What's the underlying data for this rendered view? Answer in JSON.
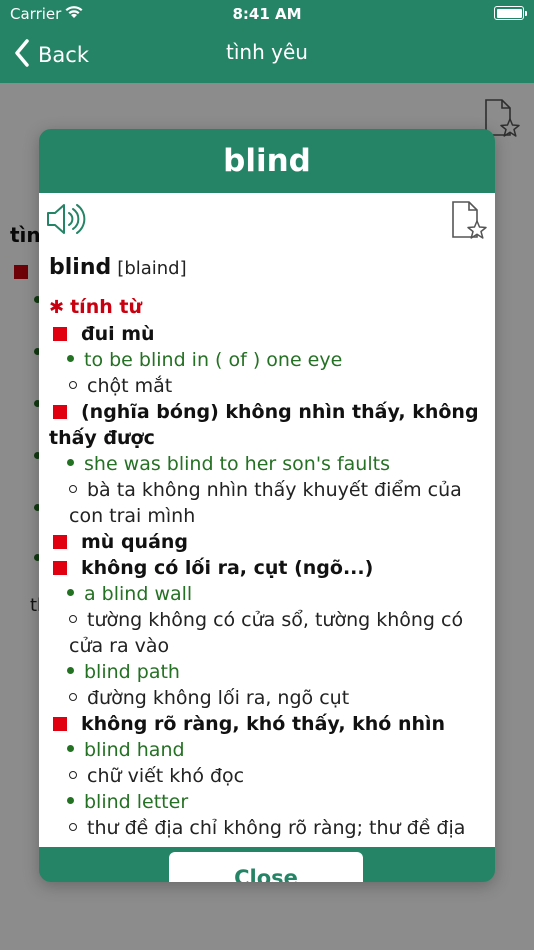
{
  "status": {
    "carrier": "Carrier",
    "time": "8:41 AM"
  },
  "nav": {
    "back_label": "Back",
    "title": "tình yêu"
  },
  "background": {
    "heading_fragment": "tìn",
    "tail_fragment": "th"
  },
  "modal": {
    "title": "blind",
    "word": "blind",
    "pronunciation": "[blaind]",
    "part_of_speech": "tính từ",
    "entries": [
      {
        "def": "đui mù",
        "items": [
          {
            "ex": "to be blind in ( of ) one eye",
            "tr": "chột mắt"
          }
        ]
      },
      {
        "def": "(nghĩa bóng) không nhìn thấy, không thấy được",
        "items": [
          {
            "ex": "she was blind to her son's faults",
            "tr": "bà ta không nhìn thấy khuyết điểm của con trai mình"
          }
        ]
      },
      {
        "def": "mù quáng",
        "items": []
      },
      {
        "def": "không có lối ra, cụt (ngõ...)",
        "items": [
          {
            "ex": "a blind wall",
            "tr": "tường không có cửa sổ, tường không có cửa ra vào"
          },
          {
            "ex": "blind path",
            "tr": "đường không lối ra, ngõ cụt"
          }
        ]
      },
      {
        "def": "không rõ ràng, khó thấy, khó nhìn",
        "items": [
          {
            "ex": "blind hand",
            "tr": "chữ viết khó đọc"
          },
          {
            "ex": "blind letter",
            "tr": "thư đề địa chỉ không rõ ràng; thư đề địa"
          }
        ]
      }
    ],
    "close_label": "Close"
  },
  "colors": {
    "primary": "#258466",
    "accent_red": "#c8000f",
    "example_green": "#257124"
  }
}
